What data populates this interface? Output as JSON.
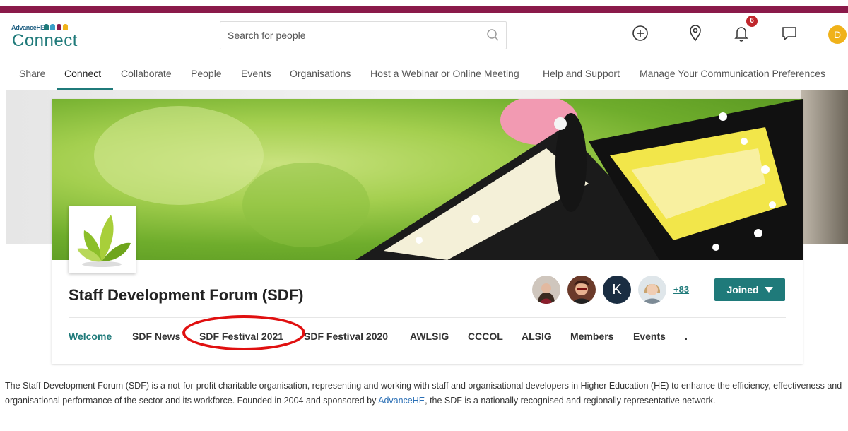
{
  "brand": {
    "small": "AdvanceHE",
    "word": "Connect",
    "colors": {
      "primary": "#1f7a7a",
      "stripe": "#8a1a4a",
      "notif": "#c0272d",
      "avatar": "#f0b21a",
      "highlight": "#e01010"
    }
  },
  "search": {
    "placeholder": "Search for people",
    "icon": "search-icon"
  },
  "header_icons": {
    "add": "plus-circle-icon",
    "location": "map-pin-icon",
    "notifications": "bell-icon",
    "notification_count": "6",
    "messages": "chat-bubble-icon",
    "user_initial": "D"
  },
  "nav": {
    "items": [
      "Share",
      "Connect",
      "Collaborate",
      "People",
      "Events",
      "Organisations",
      "Host a Webinar or Online Meeting",
      "Help and Support",
      "Manage Your Communication Preferences"
    ],
    "active": "Connect"
  },
  "group": {
    "title": "Staff Development Forum (SDF)",
    "member_initial": "K",
    "more_members": "+83",
    "joined_label": "Joined",
    "tabs": [
      "Welcome",
      "SDF News",
      "SDF Festival 2021",
      "SDF Festival 2020",
      "AWLSIG",
      "CCCOL",
      "ALSIG",
      "Members",
      "Events",
      "."
    ],
    "active_tab": "Welcome",
    "circled_tab": "SDF Festival 2021"
  },
  "description": {
    "part1": "The Staff Development Forum (SDF) is a not-for-profit charitable organisation, representing and working with staff and organisational developers in Higher Education (HE) to enhance the efficiency, effectiveness and organisational performance of the sector and its workforce. Founded in 2004 and sponsored by ",
    "link": "AdvanceHE",
    "part2": ", the SDF is a nationally recognised and regionally representative network."
  }
}
